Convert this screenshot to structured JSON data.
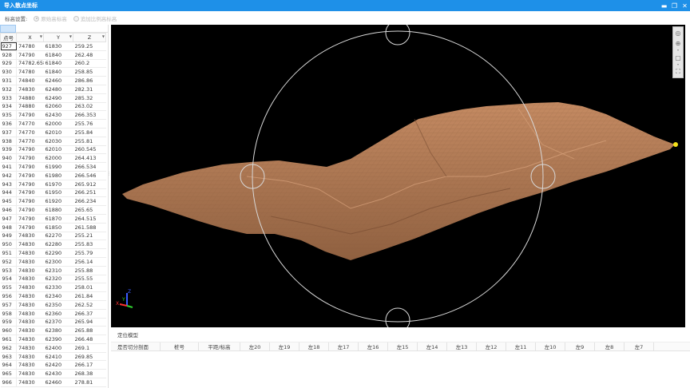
{
  "window": {
    "title": "导入散点坐标",
    "minimize_glyph": "▬",
    "restore_glyph": "❐",
    "close_glyph": "✕"
  },
  "options": {
    "label": "标高设置:",
    "radio1": "原始高标高",
    "radio2": "追加比例高标高"
  },
  "table": {
    "headers": [
      "点号",
      "X",
      "Y",
      "Z"
    ],
    "rows": [
      [
        "927",
        "74780",
        "61830",
        "259.25"
      ],
      [
        "928",
        "74790",
        "61840",
        "262.48"
      ],
      [
        "929",
        "74782.658",
        "61840",
        "260.2"
      ],
      [
        "930",
        "74780",
        "61840",
        "258.85"
      ],
      [
        "931",
        "74840",
        "62460",
        "286.86"
      ],
      [
        "932",
        "74830",
        "62480",
        "282.31"
      ],
      [
        "933",
        "74880",
        "62490",
        "285.32"
      ],
      [
        "934",
        "74880",
        "62060",
        "263.02"
      ],
      [
        "935",
        "74790",
        "62430",
        "266.353"
      ],
      [
        "936",
        "74770",
        "62000",
        "255.76"
      ],
      [
        "937",
        "74770",
        "62010",
        "255.84"
      ],
      [
        "938",
        "74770",
        "62030",
        "255.81"
      ],
      [
        "939",
        "74790",
        "62010",
        "260.545"
      ],
      [
        "940",
        "74790",
        "62000",
        "264.413"
      ],
      [
        "941",
        "74790",
        "61990",
        "266.534"
      ],
      [
        "942",
        "74790",
        "61980",
        "266.546"
      ],
      [
        "943",
        "74790",
        "61970",
        "265.912"
      ],
      [
        "944",
        "74790",
        "61950",
        "266.251"
      ],
      [
        "945",
        "74790",
        "61920",
        "266.234"
      ],
      [
        "946",
        "74790",
        "61880",
        "265.65"
      ],
      [
        "947",
        "74790",
        "61870",
        "264.515"
      ],
      [
        "948",
        "74790",
        "61850",
        "261.588"
      ],
      [
        "949",
        "74830",
        "62270",
        "255.21"
      ],
      [
        "950",
        "74830",
        "62280",
        "255.83"
      ],
      [
        "951",
        "74830",
        "62290",
        "255.79"
      ],
      [
        "952",
        "74830",
        "62300",
        "256.14"
      ],
      [
        "953",
        "74830",
        "62310",
        "255.88"
      ],
      [
        "954",
        "74830",
        "62320",
        "255.55"
      ],
      [
        "955",
        "74830",
        "62330",
        "258.01"
      ],
      [
        "956",
        "74830",
        "62340",
        "261.84"
      ],
      [
        "957",
        "74830",
        "62350",
        "262.52"
      ],
      [
        "958",
        "74830",
        "62360",
        "266.37"
      ],
      [
        "959",
        "74830",
        "62370",
        "265.94"
      ],
      [
        "960",
        "74830",
        "62380",
        "265.88"
      ],
      [
        "961",
        "74830",
        "62390",
        "266.48"
      ],
      [
        "962",
        "74830",
        "62400",
        "269.1"
      ],
      [
        "963",
        "74830",
        "62410",
        "269.85"
      ],
      [
        "964",
        "74830",
        "62420",
        "266.17"
      ],
      [
        "965",
        "74830",
        "62430",
        "268.38"
      ],
      [
        "966",
        "74830",
        "62460",
        "278.81"
      ]
    ]
  },
  "axes": {
    "x": "X",
    "y": "Y",
    "z": "Z"
  },
  "bottom": {
    "title": "定位模型",
    "columns": [
      "是否切分剖面",
      "桩号",
      "平距/标高",
      "左20",
      "左19",
      "左18",
      "左17",
      "左16",
      "左15",
      "左14",
      "左13",
      "左12",
      "左11",
      "左10",
      "左9",
      "左8",
      "左7"
    ]
  },
  "colors": {
    "titlebar": "#1e90e8",
    "terrain": "#b07a55",
    "viewport_bg": "#000000",
    "gizmo": "#d8d8d8",
    "marker": "#f5e11a"
  }
}
